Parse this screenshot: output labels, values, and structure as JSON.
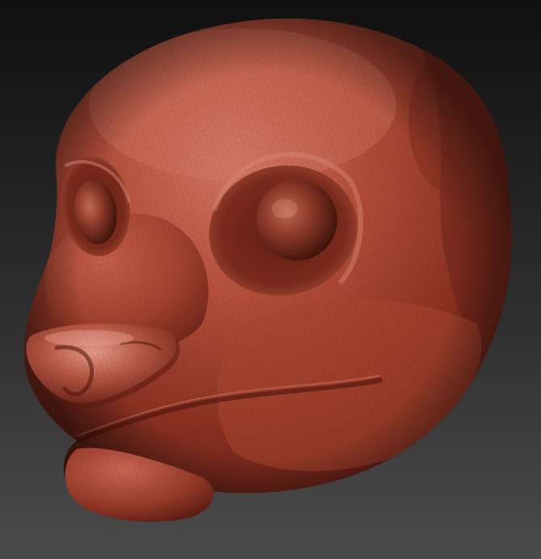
{
  "scene": {
    "subject": "sculpted-animal-head",
    "background_top": "#101010",
    "background_bottom": "#4a4a4a",
    "material_highlight": "#e09080",
    "material_light": "#c8604c",
    "material_base": "#a0402e",
    "material_shadow": "#5a1c12",
    "material_deep": "#3a0e08"
  }
}
